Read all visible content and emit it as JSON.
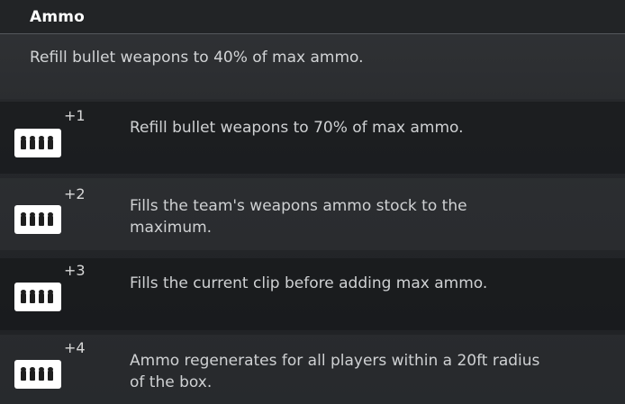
{
  "header": {
    "title": "Ammo"
  },
  "base": {
    "description": "Refill bullet weapons to 40% of max ammo."
  },
  "upgrades": [
    {
      "tier": "+1",
      "icon": "ammo-icon",
      "text": "Refill bullet weapons to 70% of max ammo."
    },
    {
      "tier": "+2",
      "icon": "ammo-icon",
      "text": "Fills the team's weapons ammo stock to the maximum."
    },
    {
      "tier": "+3",
      "icon": "ammo-icon",
      "text": "Fills the current clip before adding max ammo."
    },
    {
      "tier": "+4",
      "icon": "ammo-icon",
      "text": "Ammo regenerates for all players within a 20ft radius of the box."
    }
  ]
}
